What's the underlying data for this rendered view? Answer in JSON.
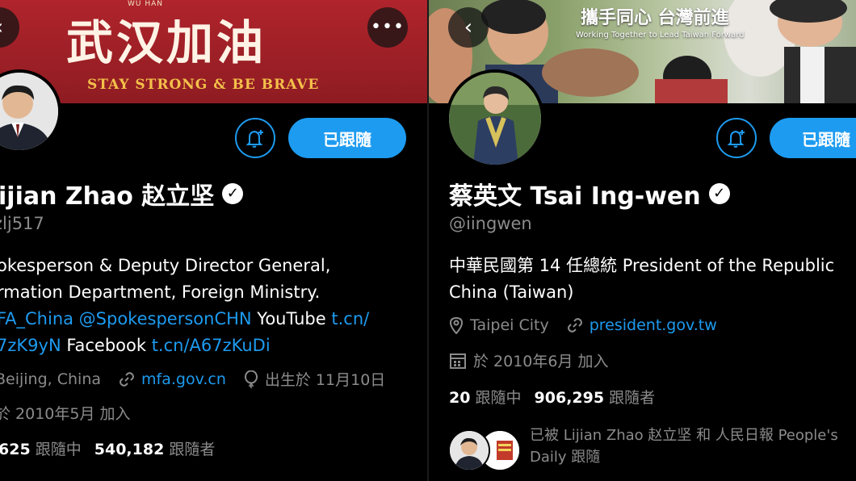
{
  "left": {
    "banner": {
      "wuhan": "WU HAN",
      "calligraphy": "武汉加油",
      "tagline": "STAY STRONG & BE BRAVE"
    },
    "follow_label": "已跟隨",
    "name": "ijian Zhao 赵立坚",
    "handle": "zlj517",
    "bio": {
      "line1": "okesperson & Deputy Director General,",
      "line2": "rmation Department, Foreign Ministry.",
      "line3_a": "FA_China @SpokespersonCHN",
      "line3_b": " YouTube ",
      "line3_c": "t.cn/",
      "line4_a": "7zK9yN",
      "line4_b": " Facebook ",
      "line4_c": "t.cn/A67zKuDi"
    },
    "location": "Beijing, China",
    "website": "mfa.gov.cn",
    "birthday": "出生於 11月10日",
    "joined": "於 2010年5月 加入",
    "following_count": "625",
    "following_label": " 跟隨中 ",
    "followers_count": "540,182",
    "followers_label": " 跟隨者"
  },
  "right": {
    "banner": {
      "slogan_cn": "攜手同心 台灣前進",
      "slogan_en": "Working Together to Lead Taiwan Forward"
    },
    "follow_label": "已跟隨",
    "name": "蔡英文 Tsai Ing-wen",
    "handle": "@iingwen",
    "bio": {
      "line1": "中華民國第 14 任總統 President of the Republic",
      "line2": "China (Taiwan)"
    },
    "location": "Taipei City",
    "website": "president.gov.tw",
    "joined": "於 2010年6月 加入",
    "following_count": "20",
    "following_label": " 跟隨中 ",
    "followers_count": "906,295",
    "followers_label": " 跟隨者",
    "followed_by_line1": "已被 Lijian Zhao 赵立坚 和 人民日報  People's",
    "followed_by_line2": "Daily 跟隨"
  },
  "colors": {
    "accent": "#1d9bf0",
    "muted": "#8b8b8b",
    "banner_red": "#b0242c",
    "tagline_gold": "#f3c04a"
  },
  "icons": [
    "more-dots-icon",
    "back-arrow-icon",
    "bell-plus-icon",
    "verified-badge-icon",
    "location-pin-icon",
    "link-icon",
    "balloon-icon",
    "calendar-icon"
  ]
}
